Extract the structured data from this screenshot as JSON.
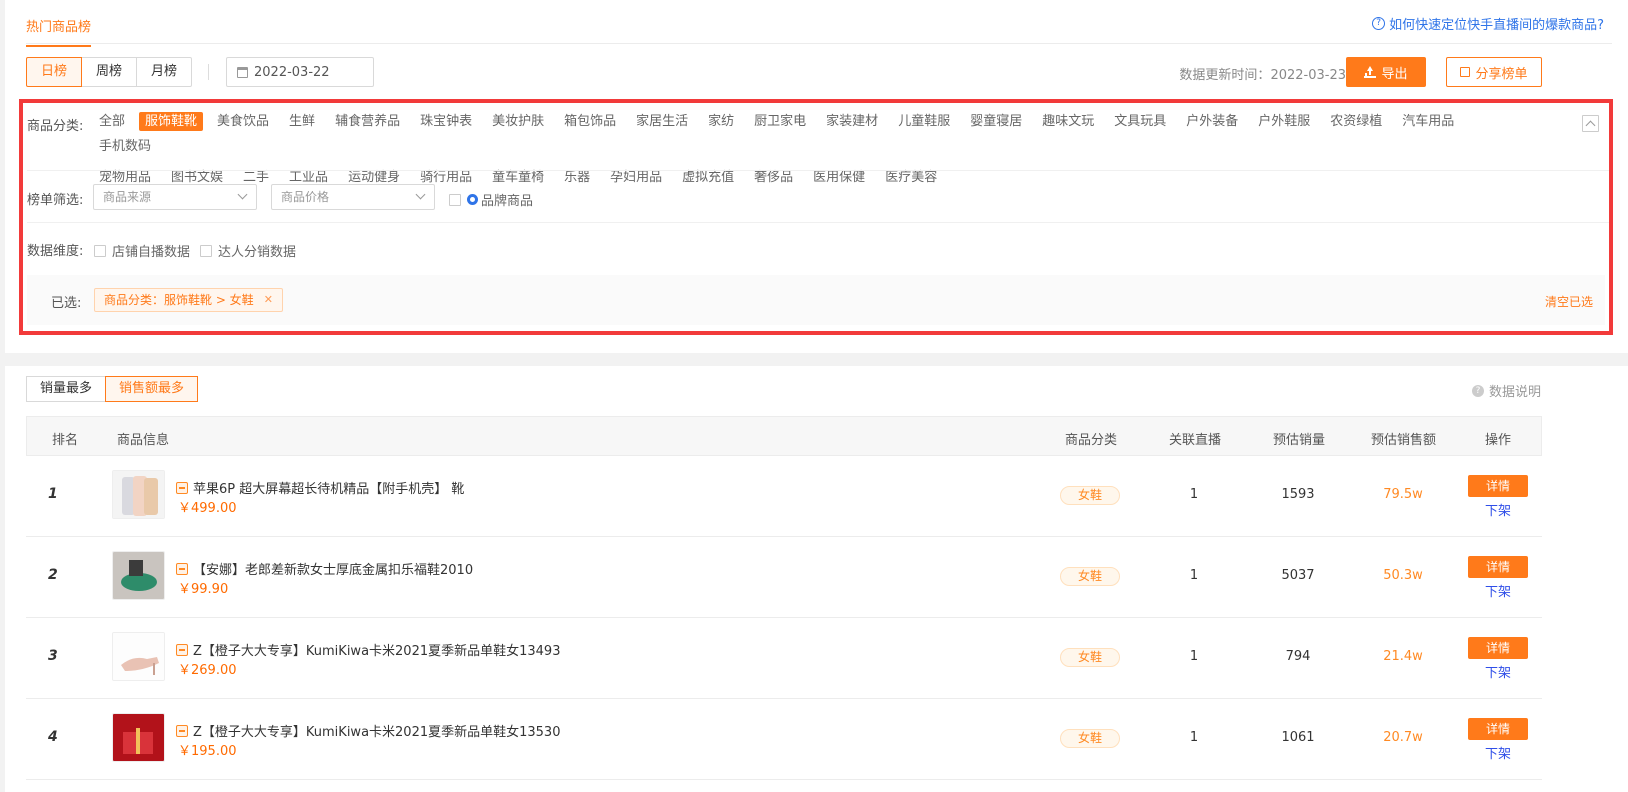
{
  "header": {
    "title_tab": "热门商品榜",
    "help_link": "如何快速定位快手直播间的爆款商品?",
    "periods": [
      "日榜",
      "周榜",
      "月榜"
    ],
    "active_period": 0,
    "date": "2022-03-22",
    "update_label": "数据更新时间：",
    "update_date": "2022-03-23",
    "export_label": "导出",
    "share_label": "分享榜单"
  },
  "filters": {
    "category_label": "商品分类:",
    "categories": [
      "全部",
      "服饰鞋靴",
      "美食饮品",
      "生鲜",
      "辅食营养品",
      "珠宝钟表",
      "美妆护肤",
      "箱包饰品",
      "家居生活",
      "家纺",
      "厨卫家电",
      "家装建材",
      "儿童鞋服",
      "婴童寝居",
      "趣味文玩",
      "文具玩具",
      "户外装备",
      "户外鞋服",
      "农资绿植",
      "汽车用品",
      "手机数码",
      "宠物用品",
      "图书文娱",
      "二手",
      "工业品",
      "运动健身",
      "骑行用品",
      "童车童椅",
      "乐器",
      "孕妇用品",
      "虚拟充值",
      "奢侈品",
      "医用保健",
      "医疗美容"
    ],
    "active_category": 1,
    "list_filter_label": "榜单筛选:",
    "source_placeholder": "商品来源",
    "price_placeholder": "商品价格",
    "brand_label": "品牌商品",
    "dimension_label": "数据维度:",
    "dimension_options": [
      "店铺自播数据",
      "达人分销数据"
    ],
    "selected_label": "已选:",
    "selected_tag": "商品分类：服饰鞋靴 > 女鞋",
    "clear_label": "清空已选"
  },
  "ranking": {
    "sort_tabs": [
      "销量最多",
      "销售额最多"
    ],
    "active_sort": 1,
    "data_note": "数据说明",
    "columns": [
      "排名",
      "商品信息",
      "商品分类",
      "关联直播",
      "预估销量",
      "预估销售额",
      "操作"
    ],
    "rows": [
      {
        "rank": "1",
        "name": "苹果6P 超大屏幕超长待机精品【附手机壳】 靴",
        "price": "￥499.00",
        "category": "女鞋",
        "live": "1",
        "sales": "1593",
        "amount": "79.5w",
        "detail": "详情",
        "off": "下架"
      },
      {
        "rank": "2",
        "name": "【安娜】老郎差新款女士厚底金属扣乐福鞋2010",
        "price": "￥99.90",
        "category": "女鞋",
        "live": "1",
        "sales": "5037",
        "amount": "50.3w",
        "detail": "详情",
        "off": "下架"
      },
      {
        "rank": "3",
        "name": "Z【橙子大大专享】KumiKiwa卡米2021夏季新品单鞋女13493",
        "price": "￥269.00",
        "category": "女鞋",
        "live": "1",
        "sales": "794",
        "amount": "21.4w",
        "detail": "详情",
        "off": "下架"
      },
      {
        "rank": "4",
        "name": "Z【橙子大大专享】KumiKiwa卡米2021夏季新品单鞋女13530",
        "price": "￥195.00",
        "category": "女鞋",
        "live": "1",
        "sales": "1061",
        "amount": "20.7w",
        "detail": "详情",
        "off": "下架"
      }
    ]
  },
  "colors": {
    "accent": "#ff7a1a",
    "highlight_border": "#f23a3a",
    "link": "#2f74e8"
  }
}
